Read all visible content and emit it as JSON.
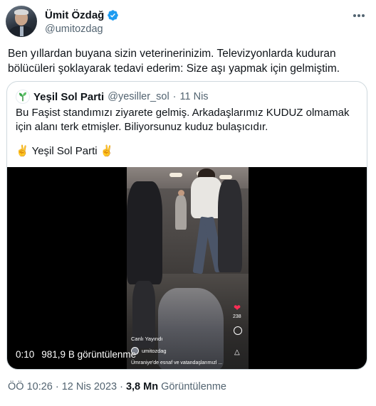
{
  "author": {
    "display_name": "Ümit Özdağ",
    "handle": "@umitozdag",
    "verified": true,
    "avatar_icon": "profile-photo"
  },
  "tweet": {
    "text": "Ben yıllardan buyana sizin veterinerinizim. Televizyonlarda kuduran bölücüleri şoklayarak tedavi ederim: Size aşı yapmak için gelmiştim."
  },
  "quote": {
    "display_name": "Yeşil Sol Parti",
    "handle": "@yesiller_sol",
    "separator": "·",
    "date": "11 Nis",
    "text": "Bu Faşist standımızı ziyarete gelmiş. Arkadaşlarımız KUDUZ olmamak için alanı terk etmişler. Biliyorsunuz kuduz bulaşıcıdır.",
    "signature": "✌️ Yeşil Sol Parti ✌️"
  },
  "video": {
    "time": "0:10",
    "views": "981,9 B görüntülenme",
    "overlay_live": "Canlı Yayındı",
    "overlay_user": "umitozdag",
    "overlay_caption": "Ümraniye'de esnaf ve vatandaşlarımızl ...",
    "overlay_like_count": "238"
  },
  "footer": {
    "time": "ÖÖ 10:26",
    "separator1": "·",
    "date": "12 Nis 2023",
    "separator2": "·",
    "views_count": "3,8 Mn",
    "views_label": "Görüntülenme"
  },
  "colors": {
    "text_primary": "#0f1419",
    "text_secondary": "#536471",
    "verified_blue": "#1d9bf0",
    "border": "#cfd9de"
  }
}
